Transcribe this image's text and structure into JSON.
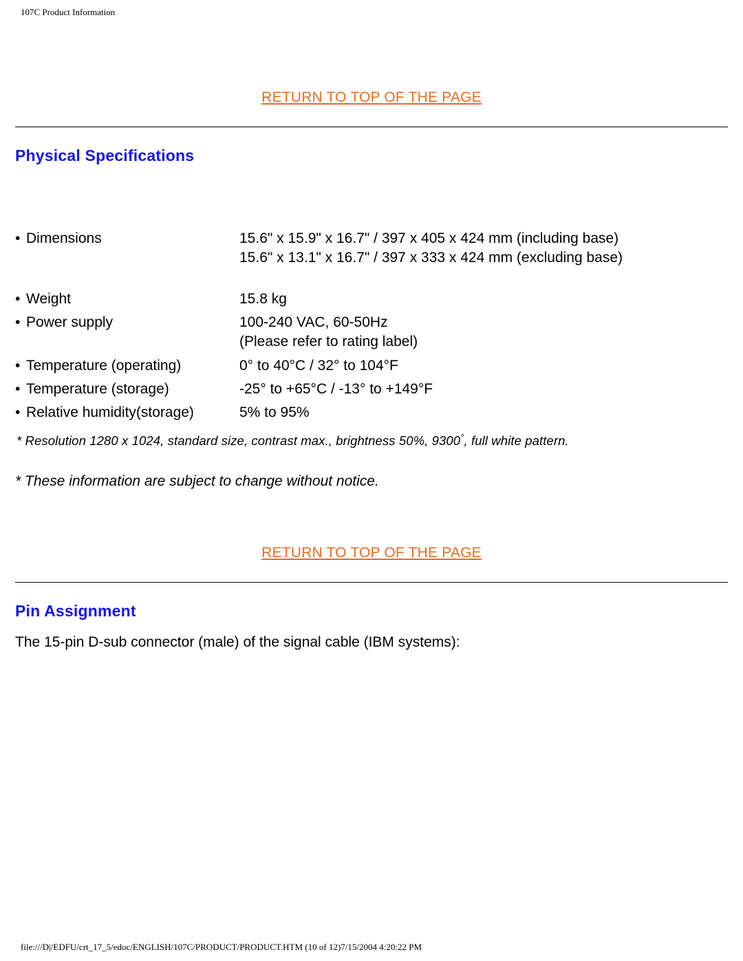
{
  "header": "107C Product Information",
  "links": {
    "return_top": "RETURN TO TOP OF THE PAGE"
  },
  "sections": {
    "physical_spec_heading": "Physical Specifications",
    "pin_assignment_heading": "Pin Assignment"
  },
  "specs": {
    "dimensions": {
      "label": "Dimensions",
      "line1": "15.6\" x 15.9\" x 16.7\" / 397 x 405 x 424 mm (including base)",
      "line2": "15.6\" x 13.1\" x 16.7\" / 397 x 333 x 424 mm (excluding base)"
    },
    "weight": {
      "label": "Weight",
      "value": "15.8 kg"
    },
    "power_supply": {
      "label": "Power supply",
      "line1": "100-240 VAC, 60-50Hz",
      "line2": "(Please refer to rating label)"
    },
    "temp_operating": {
      "label": "Temperature (operating)",
      "value": "0° to 40°C / 32° to 104°F"
    },
    "temp_storage": {
      "label": "Temperature (storage)",
      "value": "-25° to +65°C / -13° to +149°F"
    },
    "humidity_storage": {
      "label": "Relative humidity(storage)",
      "value": "5% to 95%"
    }
  },
  "footnotes": {
    "note1_prefix": "* Resolution 1280 x 1024, standard size, contrast max., brightness 50%, 9300",
    "note1_suffix": ", full white pattern.",
    "note2": "* These information are subject to change without notice."
  },
  "pin_assignment_text": "The 15-pin D-sub connector (male) of the signal cable (IBM systems):",
  "footer": "file:///D|/EDFU/crt_17_5/edoc/ENGLISH/107C/PRODUCT/PRODUCT.HTM (10 of 12)7/15/2004 4:20:22 PM"
}
